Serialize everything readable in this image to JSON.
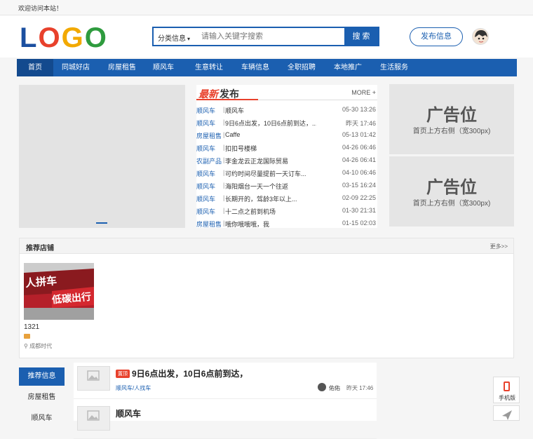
{
  "topbar": {
    "welcome": "欢迎访问本站！"
  },
  "header": {
    "logo": [
      "L",
      "O",
      "G",
      "O"
    ],
    "search": {
      "category": "分类信息",
      "placeholder": "请输入关键字搜索",
      "button": "搜 索"
    },
    "post_button": "发布信息"
  },
  "nav": {
    "items": [
      "首页",
      "同城好店",
      "房屋租售",
      "顺风车",
      "生意转让",
      "车辆信息",
      "全职招聘",
      "本地推广",
      "生活服务"
    ]
  },
  "news": {
    "title_highlight": "最新",
    "title_rest": "发布",
    "more": "MORE +",
    "rows": [
      {
        "cat": "顺风车",
        "title": "顺风车",
        "time": "05-30 13:26"
      },
      {
        "cat": "顺风车",
        "title": "9日6点出发，10日6点前到达，...",
        "time": "昨天 17:46"
      },
      {
        "cat": "房屋租售",
        "title": "Caffe",
        "time": "05-13 01:42"
      },
      {
        "cat": "顺风车",
        "title": "扣扣号楼梯",
        "time": "04-26 06:46"
      },
      {
        "cat": "农副产品",
        "title": "李金龙云正龙国际贸易",
        "time": "04-26 06:41"
      },
      {
        "cat": "顺风车",
        "title": "可约时间尽量提前一天订车...",
        "time": "04-10 06:46"
      },
      {
        "cat": "顺风车",
        "title": "海阳烟台一天一个往返",
        "time": "03-15 16:24"
      },
      {
        "cat": "顺风车",
        "title": "长期开的，驾龄3年以上...",
        "time": "02-09 22:25"
      },
      {
        "cat": "顺风车",
        "title": "十二点之前到机场",
        "time": "01-30 21:31"
      },
      {
        "cat": "房屋租售",
        "title": "哦你哦哦哦，我",
        "time": "01-15 02:03"
      }
    ]
  },
  "ads": [
    {
      "big": "广告位",
      "small": "首页上方右侧（宽300px)"
    },
    {
      "big": "广告位",
      "small": "首页上方右侧（宽300px)"
    }
  ],
  "shops": {
    "title": "推荐店铺",
    "more": "更多>>",
    "items": [
      {
        "name": "1321",
        "location": "成都时代",
        "image_text_1": "人拼车",
        "image_text_2": "低碳出行"
      }
    ]
  },
  "sidebar": {
    "items": [
      "推荐信息",
      "房屋租售",
      "顺风车"
    ]
  },
  "list": {
    "items": [
      {
        "tag": "置顶",
        "title": "9日6点出发，10日6点前到达，",
        "sub": "顺风车/人找车",
        "user": "佑佑",
        "time": "昨天 17:46"
      },
      {
        "tag": "",
        "title": "顺风车",
        "sub": "",
        "user": "",
        "time": ""
      }
    ]
  },
  "float": {
    "mobile": "手机版"
  },
  "colors": {
    "brand": "#1b5fb0",
    "accent": "#e8412c"
  }
}
